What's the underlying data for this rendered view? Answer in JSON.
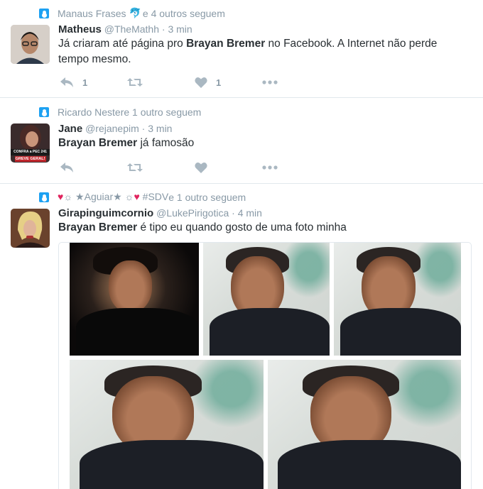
{
  "tweets": [
    {
      "context": {
        "names": "Manaus Frases",
        "emoji": "🐬",
        "suffix": " e 4 outros seguem"
      },
      "fullname": "Matheus",
      "handle": "@TheMathh",
      "time": "3 min",
      "text_parts": [
        "Já criaram até página pro ",
        "Brayan Bremer",
        " no Facebook. A Internet não perde tempo mesmo."
      ],
      "reply_count": "1",
      "retweet_count": "",
      "like_count": "1"
    },
    {
      "context": {
        "names": "Ricardo Nester",
        "emoji": "",
        "suffix": " e 1 outro seguem"
      },
      "fullname": "Jane",
      "handle": "@rejanepim",
      "time": "3 min",
      "avatar_text": [
        "CONFRA a PEC 241",
        "GREVE GERAL!"
      ],
      "text_parts": [
        "",
        "Brayan Bremer",
        " já famosão"
      ],
      "reply_count": "",
      "retweet_count": "",
      "like_count": ""
    },
    {
      "context": {
        "names": "♥☼ ★Aguiar★ ☼♥ #SDV",
        "emoji": "",
        "suffix": " e 1 outro seguem"
      },
      "fullname": "Girapinguimcornio",
      "handle": "@LukePirigotica",
      "time": "4 min",
      "text_parts": [
        "",
        "Brayan Bremer",
        " é tipo eu quando gosto de uma foto minha"
      ],
      "reply_count": "",
      "retweet_count": "",
      "like_count": ""
    }
  ],
  "separator": "·",
  "icons": {
    "context": "person-follow-icon",
    "reply": "reply-icon",
    "retweet": "retweet-icon",
    "like": "heart-icon",
    "more": "more-dots-icon"
  },
  "colors": {
    "accent": "#1da1f2",
    "muted": "#8899a6",
    "icon": "#aab8c2",
    "text": "#292f33",
    "border": "#e1e8ed"
  }
}
